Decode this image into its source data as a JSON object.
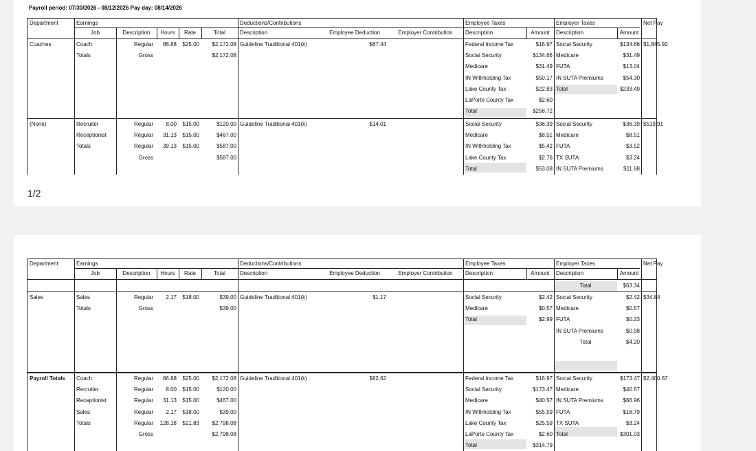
{
  "report": {
    "period_line": "Payroll period: 07/30/2026 - 08/12/2026 Pay day: 08/14/2026",
    "page_indicator": "1/2"
  },
  "headers": {
    "department": "Department",
    "earnings": "Earnings",
    "job": "Job",
    "description": "Description",
    "hours": "Hours",
    "rate": "Rate",
    "total": "Total",
    "deductions": "Deductions/Contributions",
    "employee_deduction": "Employee Deduction",
    "employer_contribution": "Employer Contribution",
    "employee_taxes": "Employee Taxes",
    "amount": "Amount",
    "employer_taxes": "Employer Taxes",
    "net_pay": "Net Pay"
  },
  "sections": {
    "coaches": {
      "department": "Coaches",
      "jobs": [
        "Coach",
        "Totals"
      ],
      "descriptions": [
        "Regular",
        "Gross"
      ],
      "hours": [
        "86.88"
      ],
      "rates": [
        "$25.00"
      ],
      "totals": [
        "$2,172.08",
        "$2,172.08"
      ],
      "deduction_desc": "Guideline Traditional 401(k)",
      "employee_deduction": "$67.44",
      "employee_taxes": [
        "Federal Income Tax",
        "Social Security",
        "Medicare",
        "IN Withholding Tax",
        "Lake County Tax",
        "LaPorte County Tax",
        "Total"
      ],
      "employee_tax_amounts": [
        "$16.97",
        "$134.66",
        "$31.49",
        "$50.17",
        "$22.83",
        "$2.60",
        "$258.72"
      ],
      "employer_taxes": [
        "Social Security",
        "Medicare",
        "FUTA",
        "IN SUTA Premiums",
        "Total"
      ],
      "employer_tax_amounts": [
        "$134.66",
        "$31.49",
        "$13.04",
        "$54.30",
        "$233.49"
      ],
      "net_pay": "$1,845.92"
    },
    "none": {
      "department": "(None)",
      "jobs": [
        "Recruiter",
        "Receptionist",
        "Totals"
      ],
      "descriptions": [
        "Regular",
        "Regular",
        "Regular",
        "Gross"
      ],
      "hours": [
        "8.00",
        "31.13",
        "39.13"
      ],
      "rates": [
        "$15.00",
        "$15.00",
        "$15.00"
      ],
      "totals": [
        "$120.00",
        "$467.00",
        "$587.00",
        "$587.00"
      ],
      "deduction_desc": "Guideline Traditional 401(k)",
      "employee_deduction": "$14.01",
      "employee_taxes": [
        "Social Security",
        "Medicare",
        "IN Withholding Tax",
        "Lake County Tax",
        "Total"
      ],
      "employee_tax_amounts": [
        "$36.39",
        "$8.51",
        "$5.42",
        "$2.76",
        "$53.08"
      ],
      "employer_taxes": [
        "Social Security",
        "Medicare",
        "FUTA",
        "TX SUTA",
        "IN SUTA Premiums"
      ],
      "employer_tax_amounts": [
        "$36.39",
        "$8.51",
        "$3.52",
        "$3.24",
        "$11.68"
      ],
      "net_pay": "$519.91"
    },
    "carry": {
      "employer_tax_label": "Total",
      "employer_tax_amount": "$63.34"
    },
    "sales": {
      "department": "Sales",
      "jobs": [
        "Sales",
        "Totals"
      ],
      "descriptions": [
        "Regular",
        "Gross"
      ],
      "hours": [
        "2.17"
      ],
      "rates": [
        "$18.00"
      ],
      "totals": [
        "$39.00",
        "$39.00"
      ],
      "deduction_desc": "Guideline Traditional 401(k)",
      "employee_deduction": "$1.17",
      "employee_taxes": [
        "Social Security",
        "Medicare",
        "Total"
      ],
      "employee_tax_amounts": [
        "$2.42",
        "$0.57",
        "$2.99"
      ],
      "employer_taxes": [
        "Social Security",
        "Medicare",
        "FUTA",
        "IN SUTA Premiums",
        "Total"
      ],
      "employer_tax_amounts": [
        "$2.42",
        "$0.57",
        "$0.23",
        "$0.98",
        "$4.20"
      ],
      "net_pay": "$34.84"
    },
    "payroll_totals": {
      "department": "Payroll Totals",
      "jobs": [
        "Coach",
        "Recruiter",
        "Receptionist",
        "Sales",
        "Totals"
      ],
      "descriptions": [
        "Regular",
        "Regular",
        "Regular",
        "Regular",
        "Regular",
        "Gross"
      ],
      "hours": [
        "86.88",
        "8.00",
        "31.13",
        "2.17",
        "128.18"
      ],
      "rates": [
        "$25.00",
        "$15.00",
        "$15.00",
        "$18.00",
        "$21.83"
      ],
      "totals": [
        "$2,172.08",
        "$120.00",
        "$467.00",
        "$39.00",
        "$2,798.08",
        "$2,798.08"
      ],
      "deduction_desc": "Guideline Traditional 401(k)",
      "employee_deduction": "$82.62",
      "employee_taxes": [
        "Federal Income Tax",
        "Social Security",
        "Medicare",
        "IN Withholding Tax",
        "Lake County Tax",
        "LaPorte County Tax",
        "Total"
      ],
      "employee_tax_amounts": [
        "$16.97",
        "$173.47",
        "$40.57",
        "$55.59",
        "$25.59",
        "$2.60",
        "$314.79"
      ],
      "employer_taxes": [
        "Social Security",
        "Medicare",
        "IN SUTA Premiums",
        "FUTA",
        "TX SUTA",
        "Total"
      ],
      "employer_tax_amounts": [
        "$173.47",
        "$40.57",
        "$66.96",
        "$16.79",
        "$3.24",
        "$301.03"
      ],
      "net_pay": "$2,400.67"
    }
  }
}
